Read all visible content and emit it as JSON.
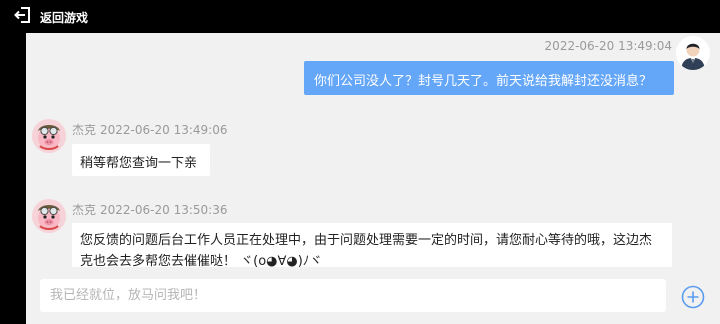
{
  "header": {
    "back_label": "返回游戏",
    "back_icon": "exit-arrow-icon"
  },
  "messages": [
    {
      "side": "right",
      "timestamp": "2022-06-20 13:49:04",
      "text": "你们公司没人了？封号几天了。前天说给我解封还没消息？",
      "avatar": "agent-avatar"
    },
    {
      "side": "left",
      "sender": "杰克",
      "timestamp": "2022-06-20 13:49:06",
      "text": "稍等帮您查询一下亲",
      "avatar": "pig-mascot-avatar"
    },
    {
      "side": "left",
      "sender": "杰克",
      "timestamp": "2022-06-20 13:50:36",
      "text": "您反馈的问题后台工作人员正在处理中，由于问题处理需要一定的时间，请您耐心等待的哦，这边杰克也会去多帮您去催催哒！ ヾ(o◕∀◕)ﾉヾ",
      "avatar": "pig-mascot-avatar"
    }
  ],
  "input": {
    "placeholder": "我已经就位，放马问我吧！"
  },
  "colors": {
    "user_bubble": "#64a6f7",
    "chat_bg": "#f1f1f1",
    "timestamp": "#9a9a9a",
    "plus": "#5b9cf0"
  }
}
